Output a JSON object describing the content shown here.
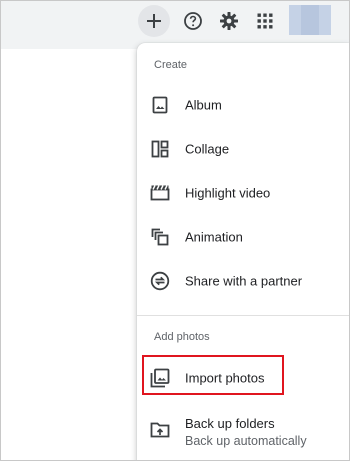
{
  "toolbar": {
    "create_icon": "plus-icon",
    "help_icon": "help-circle-icon",
    "settings_icon": "gear-icon",
    "apps_icon": "apps-grid-icon"
  },
  "menu": {
    "create_section": {
      "label": "Create",
      "items": [
        {
          "label": "Album",
          "icon": "album-icon"
        },
        {
          "label": "Collage",
          "icon": "collage-icon"
        },
        {
          "label": "Highlight video",
          "icon": "highlight-video-icon"
        },
        {
          "label": "Animation",
          "icon": "animation-icon"
        },
        {
          "label": "Share with a partner",
          "icon": "partner-share-icon"
        }
      ]
    },
    "add_section": {
      "label": "Add photos",
      "items": [
        {
          "label": "Import photos",
          "icon": "import-photos-icon"
        },
        {
          "label": "Back up folders",
          "sublabel": "Back up automatically",
          "icon": "backup-folder-icon"
        }
      ]
    }
  },
  "colors": {
    "highlight_border": "#e0151f",
    "topbar_bg": "#f1f3f4",
    "icon": "#3c4043"
  }
}
